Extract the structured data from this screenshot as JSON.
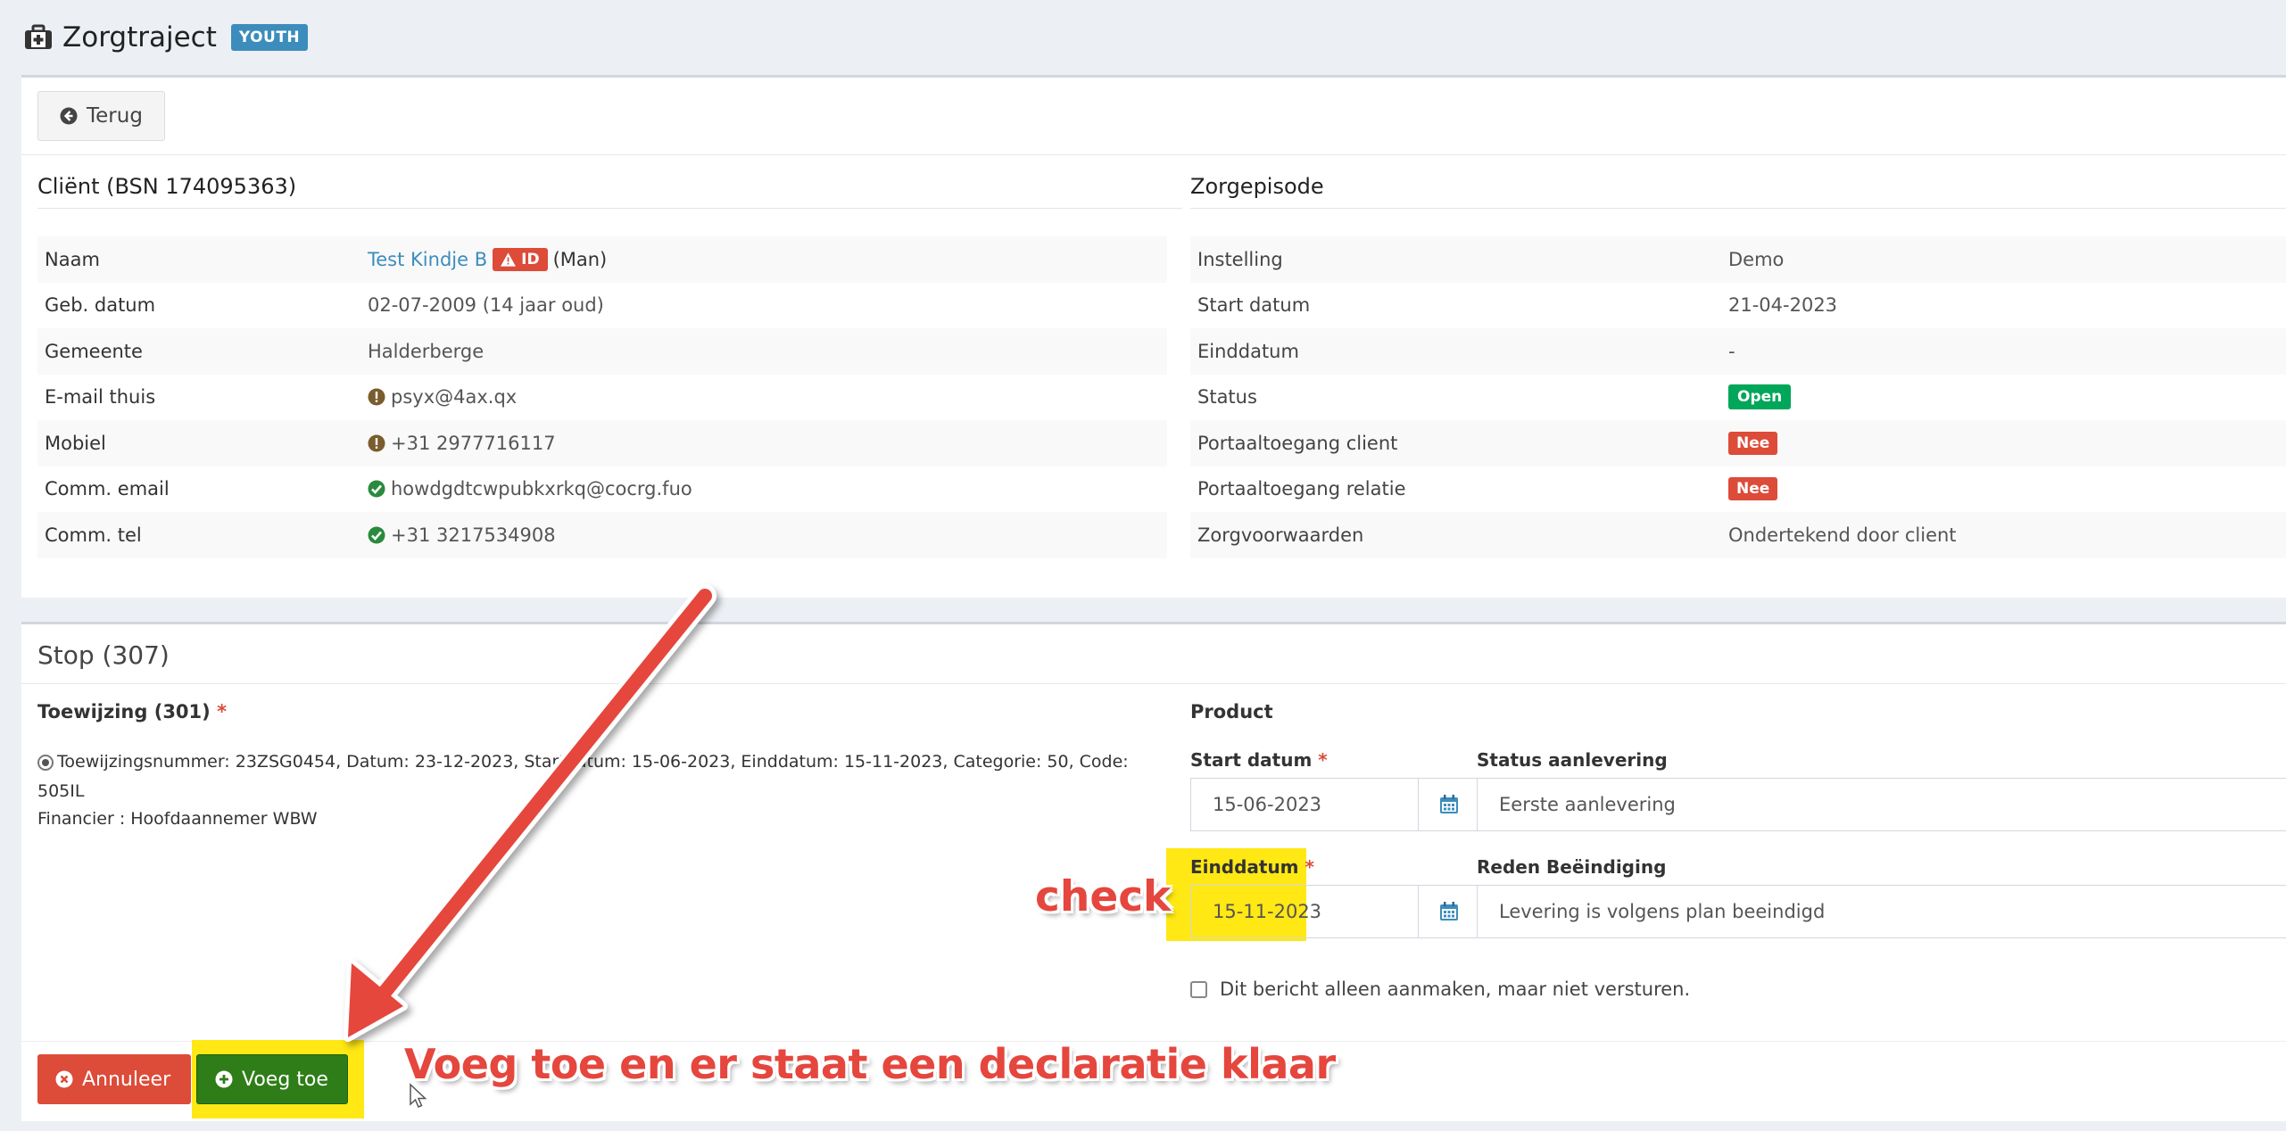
{
  "header": {
    "title": "Zorgtraject",
    "badge": "YOUTH"
  },
  "toolbar": {
    "back_label": "Terug"
  },
  "client": {
    "title": "Cliënt (BSN 174095363)",
    "rows": [
      {
        "label": "Naam",
        "name": "Test Kindje B",
        "id_badge": "ID",
        "gender": "(Man)"
      },
      {
        "label": "Geb. datum",
        "value": "02-07-2009 (14 jaar oud)"
      },
      {
        "label": "Gemeente",
        "value": "Halderberge"
      },
      {
        "label": "E-mail thuis",
        "value": "psyx@4ax.qx"
      },
      {
        "label": "Mobiel",
        "value": "+31 2977716117"
      },
      {
        "label": "Comm. email",
        "value": "howdgdtcwpubkxrkq@cocrg.fuo"
      },
      {
        "label": "Comm. tel",
        "value": "+31 3217534908"
      }
    ]
  },
  "episode": {
    "title": "Zorgepisode",
    "rows": [
      {
        "label": "Instelling",
        "value": "Demo"
      },
      {
        "label": "Start datum",
        "value": "21-04-2023"
      },
      {
        "label": "Einddatum",
        "value": "-"
      },
      {
        "label": "Status",
        "value": "Open"
      },
      {
        "label": "Portaaltoegang client",
        "value": "Nee"
      },
      {
        "label": "Portaaltoegang relatie",
        "value": "Nee"
      },
      {
        "label": "Zorgvoorwaarden",
        "value": "Ondertekend door client"
      }
    ]
  },
  "stop": {
    "title": "Stop (307)",
    "toewijzing_label": "Toewijzing (301)",
    "required_mark": "*",
    "toewijzing_text": "Toewijzingsnummer: 23ZSG0454, Datum: 23-12-2023, Startdatum: 15-06-2023, Einddatum: 15-11-2023, Categorie: 50, Code: 505IL",
    "financier": "Financier : Hoofdaannemer WBW",
    "product_label": "Product",
    "start_label": "Start datum",
    "start_value": "15-06-2023",
    "status_label": "Status aanlevering",
    "status_value": "Eerste aanlevering",
    "eind_label": "Einddatum",
    "eind_value": "15-11-2023",
    "reden_label": "Reden Beëindiging",
    "reden_value": "Levering is volgens plan beeindigd",
    "checkbox_label": "Dit bericht alleen aanmaken, maar niet versturen.",
    "cancel_label": "Annuleer",
    "add_label": "Voeg toe"
  },
  "annotations": {
    "check": "check",
    "instruction": "Voeg toe en er staat een declaratie klaar"
  },
  "colors": {
    "primary": "#3c8dbc",
    "danger": "#dd4b39",
    "success": "#00a65a",
    "highlight": "#ffe600",
    "annotation": "#e5463d"
  }
}
